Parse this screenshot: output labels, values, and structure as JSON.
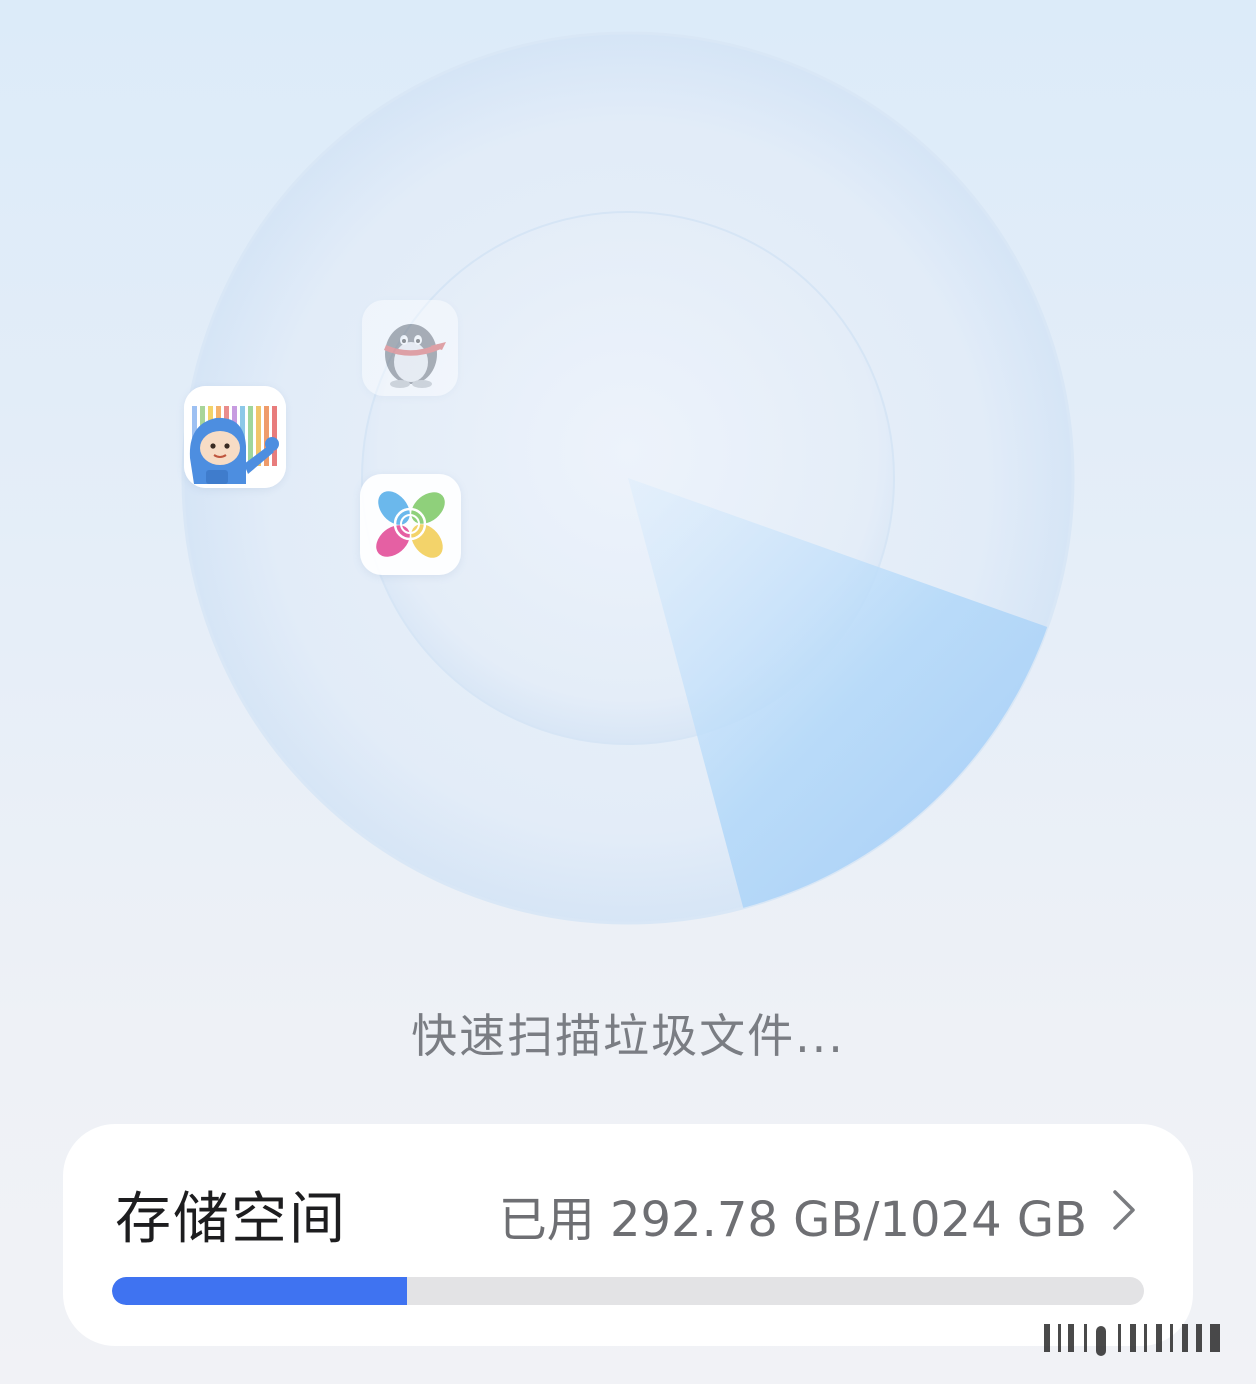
{
  "scan": {
    "status_text": "快速扫描垃圾文件...",
    "apps": [
      {
        "name": "qq-penguin-icon",
        "label": "QQ"
      },
      {
        "name": "mascot-barcode-icon",
        "label": "app"
      },
      {
        "name": "clover-icon",
        "label": "app"
      }
    ],
    "progress_sweep_fraction": 0.28
  },
  "storage": {
    "title": "存储空间",
    "usage_text": "已用 292.78 GB/1024 GB",
    "used_gb": 292.78,
    "total_gb": 1024,
    "used_fraction": 0.286
  },
  "colors": {
    "progress_fill": "#3f73f1",
    "progress_track": "#e3e3e5",
    "sweep": "#a9d2fa"
  }
}
